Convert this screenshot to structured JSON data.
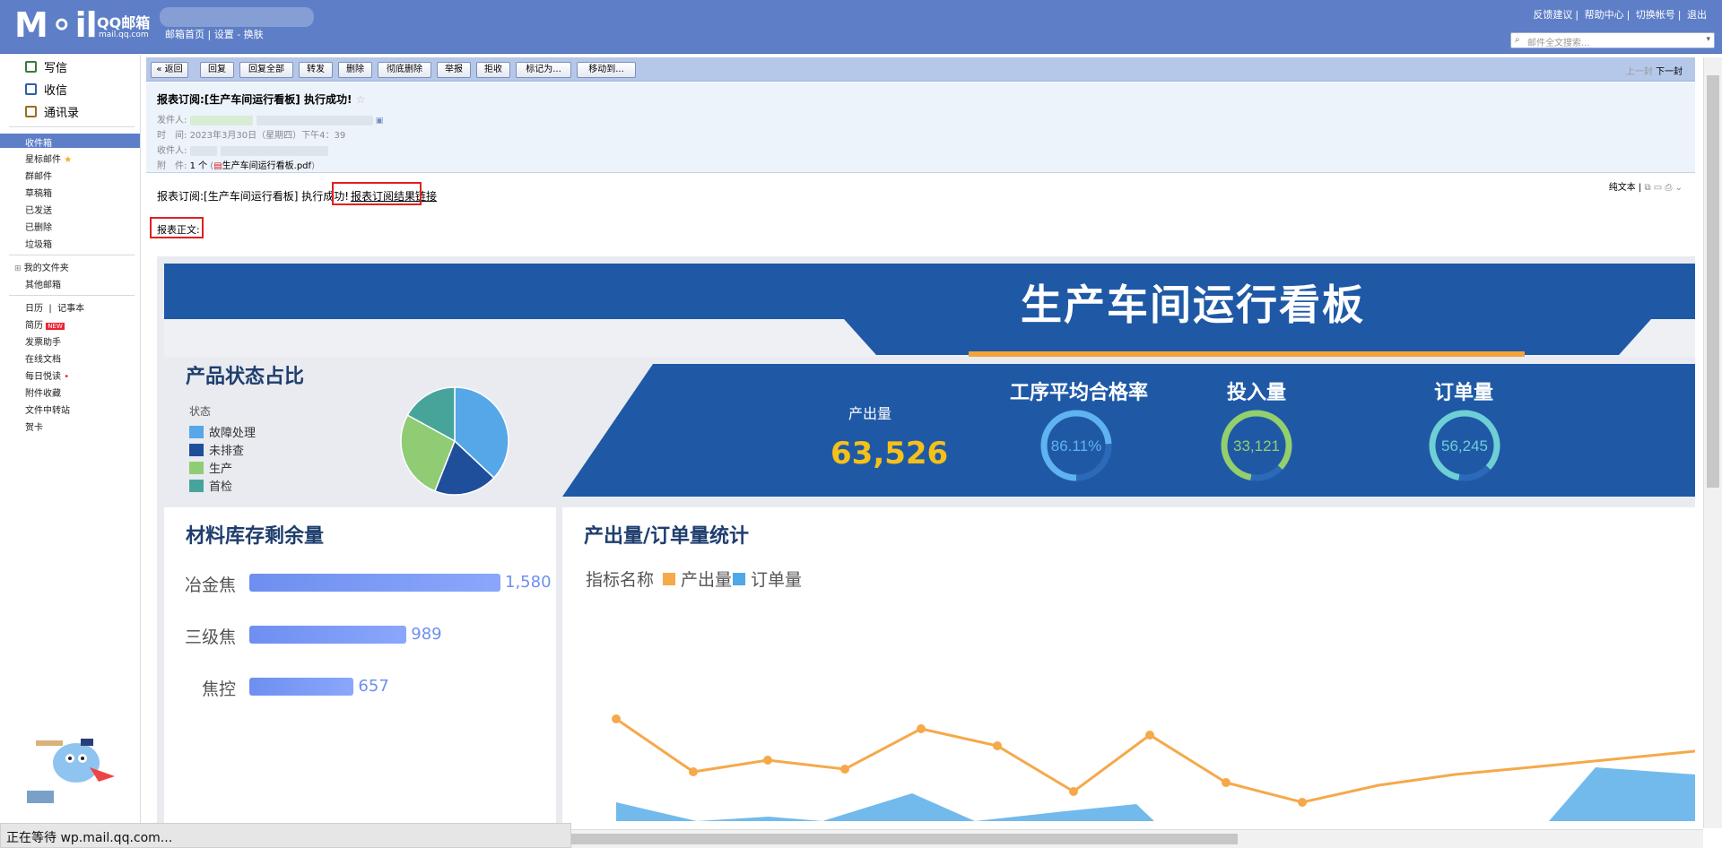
{
  "header": {
    "logo_text": "M⚬il",
    "brand": "QQ邮箱",
    "domain": "mail.qq.com",
    "links": "邮箱首页 | 设置 - 换肤",
    "top_links": [
      "反馈建议",
      "帮助中心",
      "切换帐号",
      "退出"
    ],
    "search_placeholder": "邮件全文搜索..."
  },
  "sidebar": {
    "compose": "写信",
    "receive": "收信",
    "contacts": "通讯录",
    "folders": [
      "收件箱",
      "星标邮件",
      "群邮件",
      "草稿箱",
      "已发送",
      "已删除",
      "垃圾箱"
    ],
    "my_folders": "我的文件夹",
    "other": "其他邮箱",
    "tools": [
      "日历",
      "记事本",
      "简历",
      "发票助手",
      "在线文档",
      "每日悦读",
      "附件收藏",
      "文件中转站",
      "贺卡"
    ],
    "new_badge": "NEW"
  },
  "toolbar": {
    "buttons": [
      "« 返回",
      "回复",
      "回复全部",
      "转发",
      "删除",
      "彻底删除",
      "举报",
      "拒收",
      "标记为...",
      "移动到..."
    ],
    "prev": "上一封",
    "next": "下一封"
  },
  "mail": {
    "subject": "报表订阅:[生产车间运行看板] 执行成功!",
    "sender_label": "发件人:",
    "time_label": "时　间:",
    "time_value": "2023年3月30日（星期四）下午4：39",
    "recipient_label": "收件人:",
    "attach_label": "附　件:",
    "attach_count": "1 个",
    "attach_file": "生产车间运行看板.pdf",
    "plain_text": "纯文本",
    "body_text": "报表订阅:[生产车间运行看板] 执行成功!",
    "body_link": "报表订阅结果链接",
    "body_label": "报表正文:"
  },
  "dashboard": {
    "title": "生产车间运行看板",
    "panel1_title": "产品状态占比",
    "legend_title": "状态",
    "pie": {
      "type": "pie",
      "labels": [
        "故障处理",
        "未排查",
        "生产",
        "首检"
      ],
      "values": [
        37,
        19,
        27,
        17
      ],
      "colors": [
        "#56a7e8",
        "#1f4f9b",
        "#90cc74",
        "#47a49b"
      ]
    },
    "kpi": {
      "output_label": "产出量",
      "output_value": "63,526",
      "rate_label": "工序平均合格率",
      "rate_value": "86.11%",
      "rate_fraction": 0.8611,
      "input_label": "投入量",
      "input_value": "33,121",
      "order_label": "订单量",
      "order_value": "56,245"
    },
    "panel3_title": "材料库存剩余量",
    "inventory": {
      "type": "bar",
      "categories": [
        "冶金焦",
        "三级焦",
        "焦控"
      ],
      "values": [
        1580,
        989,
        657
      ],
      "labels": [
        "1,580",
        "989",
        "657"
      ]
    },
    "panel4_title": "产出量/订单量统计",
    "legend_name": "指标名称",
    "series_names": [
      "产出量",
      "订单量"
    ],
    "series_colors": [
      "#f5a94a",
      "#4fa8e8"
    ]
  },
  "status_text": "正在等待 wp.mail.qq.com..."
}
